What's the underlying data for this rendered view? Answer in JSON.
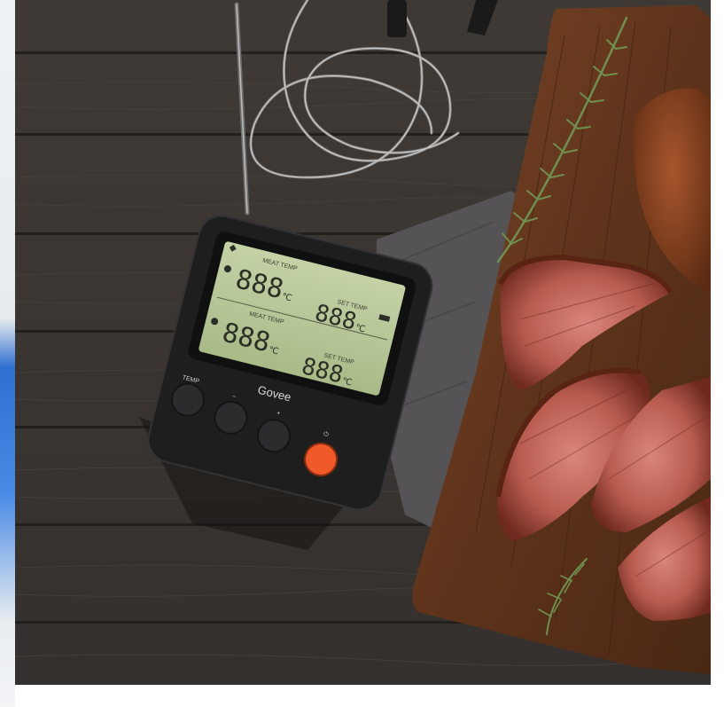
{
  "image": {
    "subject": "digital meat thermometer",
    "colors": {
      "wood": "#3b3633",
      "board": "#6b3a1f",
      "device_body": "#1e1e1f",
      "lcd": "#b8c79a",
      "power_button": "#f05a28"
    }
  },
  "device": {
    "brand": "Govee",
    "probe1_label": "MEAT TEMP",
    "probe1_set_label": "SET TEMP",
    "probe2_label": "MEAT TEMP",
    "probe2_set_label": "SET TEMP",
    "digits": "888",
    "unit": "℃",
    "buttons": {
      "temp": "TEMP",
      "minus": "−",
      "plus": "+",
      "power": "⏻"
    }
  }
}
